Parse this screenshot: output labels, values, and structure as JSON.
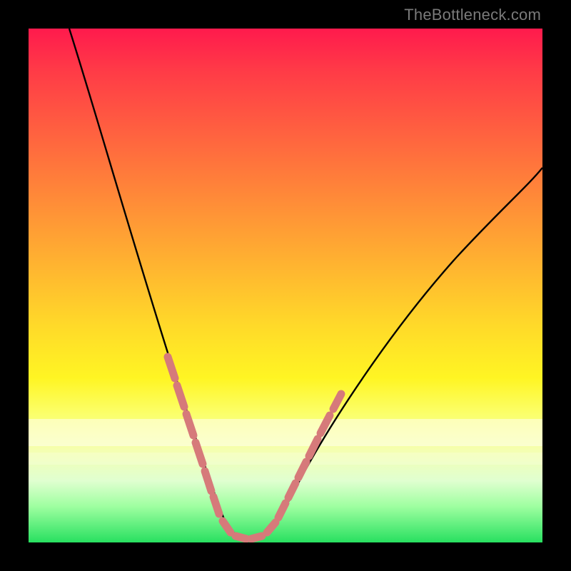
{
  "watermark": "TheBottleneck.com",
  "chart_data": {
    "type": "line",
    "title": "",
    "xlabel": "",
    "ylabel": "",
    "xlim": [
      0,
      100
    ],
    "ylim": [
      0,
      100
    ],
    "series": [
      {
        "name": "bottleneck-curve",
        "x": [
          8,
          10,
          12,
          15,
          18,
          21,
          24,
          27,
          30,
          32,
          34,
          36,
          38,
          40,
          42,
          45,
          50,
          55,
          60,
          65,
          70,
          75,
          80,
          85,
          90,
          95,
          100
        ],
        "y": [
          100,
          93,
          86,
          76,
          66,
          56,
          47,
          38,
          29,
          22,
          15,
          9,
          4,
          1,
          0,
          1,
          5,
          12,
          20,
          28,
          36,
          44,
          51,
          58,
          64,
          69,
          73
        ]
      },
      {
        "name": "highlight-dashes-left",
        "x": [
          27.5,
          29,
          30.5,
          32,
          33,
          34,
          35,
          36,
          37
        ],
        "y": [
          37,
          32,
          26,
          21,
          17,
          13,
          10,
          7,
          4
        ]
      },
      {
        "name": "highlight-dashes-bottom",
        "x": [
          38,
          39,
          40,
          41,
          42,
          43,
          44,
          45
        ],
        "y": [
          2,
          1,
          0.5,
          0.3,
          0.3,
          0.6,
          1.2,
          2
        ]
      },
      {
        "name": "highlight-dashes-right",
        "x": [
          46,
          47.5,
          49,
          50.5,
          52,
          54,
          56
        ],
        "y": [
          3,
          5,
          7.5,
          10,
          13,
          17,
          21
        ]
      }
    ],
    "grid": false,
    "legend": false,
    "annotations": []
  },
  "colors": {
    "curve": "#000000",
    "highlight": "#d67a7a",
    "gradient_top": "#ff1a4d",
    "gradient_bottom": "#28e060"
  }
}
